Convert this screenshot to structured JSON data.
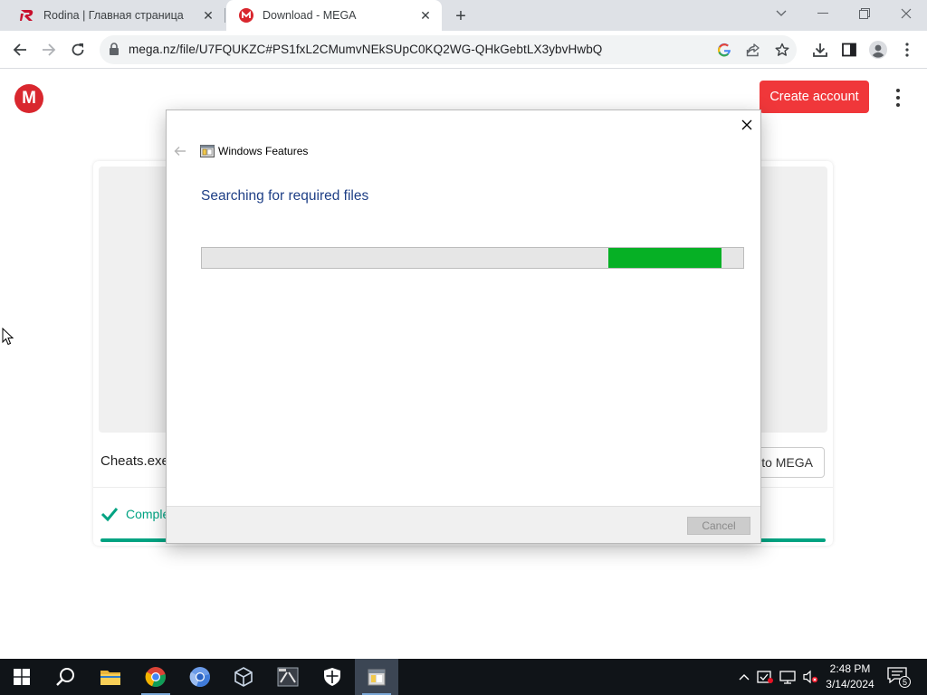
{
  "browser": {
    "tabs": [
      {
        "title": "Rodina | Главная страница",
        "favicon": "rodina-logo-icon"
      },
      {
        "title": "Download - MEGA",
        "favicon": "mega-logo-icon"
      }
    ],
    "url": "mega.nz/file/U7FQUKZC#PS1fxL2CMumvNEkSUpC0KQ2WG-QHkGebtLX3ybvHwbQ"
  },
  "mega": {
    "logo_letter": "M",
    "create_account_label": "Create account",
    "file_name": "Cheats.exe",
    "save_label": "to MEGA",
    "status_text": "Completed",
    "download_progress": 1.0,
    "accent_color": "#d9272e",
    "status_color": "#00a382"
  },
  "dialog": {
    "title": "Windows Features",
    "heading": "Searching for required files",
    "progress_marquee_start": 0.75,
    "progress_marquee_end": 0.96,
    "progress_color": "#06b025",
    "cancel_label": "Cancel"
  },
  "taskbar": {
    "time": "2:48 PM",
    "date": "3/14/2024",
    "notification_count": "5"
  }
}
